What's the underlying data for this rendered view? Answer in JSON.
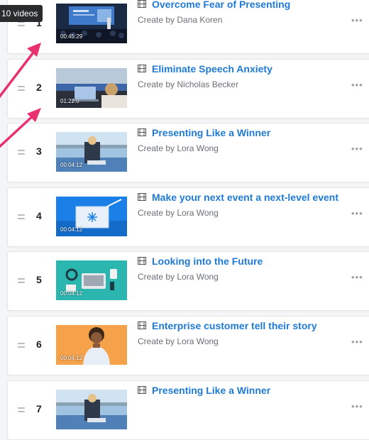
{
  "tooltip": "10 videos",
  "items": [
    {
      "number": "1",
      "title": "Overcome Fear of Presenting",
      "author": "Create by Dana Koren",
      "duration": "00:45:29",
      "thumb": "stage"
    },
    {
      "number": "2",
      "title": "Eliminate Speech Anxiety",
      "author": "Create by Nicholas Becker",
      "duration": "01:22:0",
      "thumb": "laptop-hall"
    },
    {
      "number": "3",
      "title": "Presenting Like a Winner",
      "author": "Create by Lora Wong",
      "duration": "00:04:12",
      "thumb": "lake"
    },
    {
      "number": "4",
      "title": "Make your next event a next-level event",
      "author": "Create by Lora Wong",
      "duration": "00:04:12",
      "thumb": "blue-box"
    },
    {
      "number": "5",
      "title": "Looking into the Future",
      "author": "Create by Lora Wong",
      "duration": "00:04:12",
      "thumb": "teal-desk"
    },
    {
      "number": "6",
      "title": "Enterprise customer tell their story",
      "author": "Create by Lora Wong",
      "duration": "00:04:12",
      "thumb": "orange-portrait"
    },
    {
      "number": "7",
      "title": "Presenting Like a Winner",
      "author": "",
      "duration": "",
      "thumb": "lake"
    }
  ],
  "colors": {
    "title_link": "#1f7ad6",
    "arrow": "#e8316f",
    "badge_bg": "#2a2b2d"
  }
}
